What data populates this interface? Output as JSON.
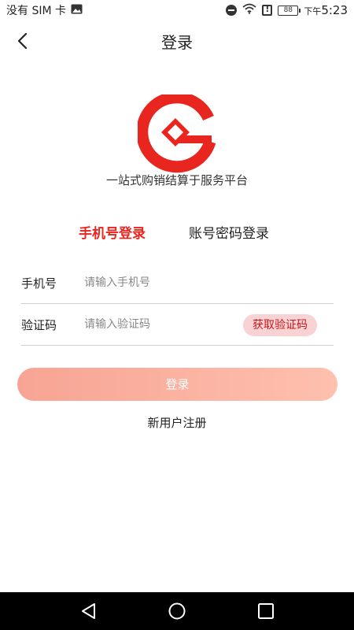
{
  "status_bar": {
    "carrier": "没有 SIM 卡",
    "battery": "88",
    "time_prefix": "下午",
    "time": "5:23"
  },
  "header": {
    "title": "登录"
  },
  "brand": {
    "slogan": "一站式购销结算于服务平台",
    "logo_color": "#e8251e"
  },
  "tabs": [
    {
      "label": "手机号登录",
      "active": true
    },
    {
      "label": "账号密码登录",
      "active": false
    }
  ],
  "form": {
    "phone_label": "手机号",
    "phone_placeholder": "请输入手机号",
    "code_label": "验证码",
    "code_placeholder": "请输入验证码",
    "get_code_label": "获取验证码"
  },
  "actions": {
    "login_label": "登录",
    "register_label": "新用户注册"
  },
  "colors": {
    "accent": "#e8251e",
    "login_button_start": "#f7a494",
    "login_button_end": "#ffc0ae",
    "code_button_bg": "#f9d3d4"
  },
  "icons": {
    "status": [
      "image-icon",
      "do-not-disturb-icon",
      "wifi-icon",
      "alert-icon",
      "battery-icon"
    ],
    "nav": [
      "nav-back-icon",
      "nav-home-icon",
      "nav-recents-icon"
    ]
  }
}
